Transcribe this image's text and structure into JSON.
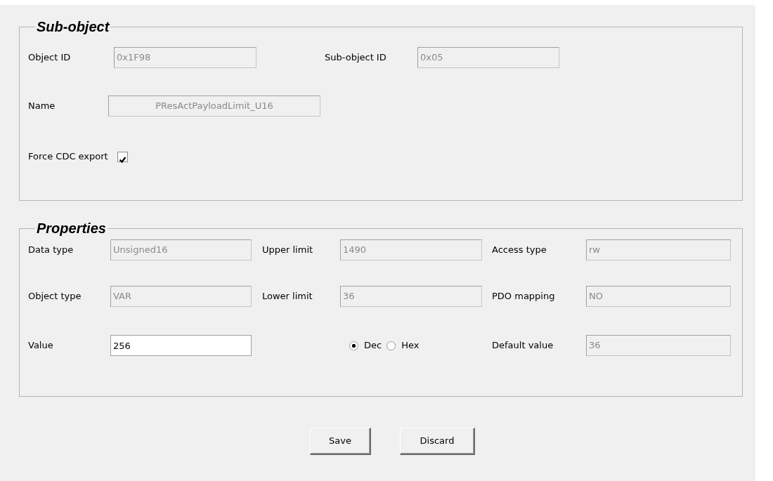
{
  "sub_object": {
    "title": "Sub-object",
    "object_id": {
      "label": "Object ID",
      "value": "0x1F98"
    },
    "sub_object_id": {
      "label": "Sub-object ID",
      "value": "0x05"
    },
    "name": {
      "label": "Name",
      "value": "PResActPayloadLimit_U16"
    },
    "force_cdc_export": {
      "label": "Force CDC export",
      "checked": true
    }
  },
  "properties": {
    "title": "Properties",
    "rows": [
      [
        {
          "kind": "readonly",
          "label": "Data type",
          "value": "Unsigned16"
        },
        {
          "kind": "readonly",
          "label": "Upper limit",
          "value": "1490"
        },
        {
          "kind": "readonly",
          "label": "Access type",
          "value": "rw"
        }
      ],
      [
        {
          "kind": "readonly",
          "label": "Object type",
          "value": "VAR"
        },
        {
          "kind": "readonly",
          "label": "Lower limit",
          "value": "36"
        },
        {
          "kind": "readonly",
          "label": "PDO mapping",
          "value": "NO"
        }
      ],
      [
        {
          "kind": "input",
          "label": "Value",
          "value": "256"
        },
        {
          "kind": "radio",
          "options": [
            {
              "label": "Dec",
              "selected": true
            },
            {
              "label": "Hex",
              "selected": false
            }
          ]
        },
        {
          "kind": "readonly",
          "label": "Default value",
          "value": "36"
        }
      ]
    ]
  },
  "buttons": [
    {
      "label": "Save"
    },
    {
      "label": "Discard"
    }
  ]
}
